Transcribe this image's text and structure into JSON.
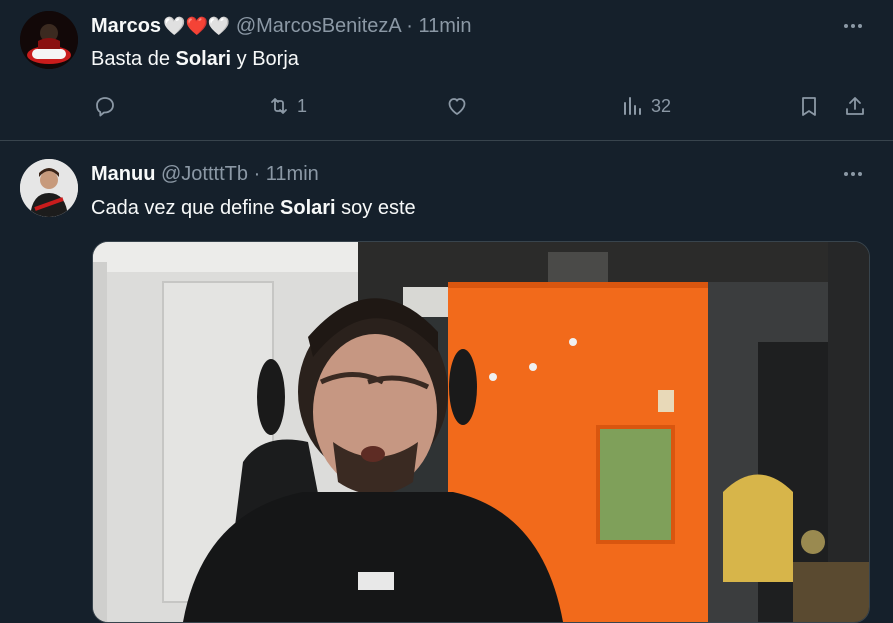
{
  "tweets": [
    {
      "name": "Marcos",
      "name_emojis": "🤍❤️🤍",
      "handle": "@MarcosBenitezA",
      "separator": "·",
      "time": "11min",
      "text_before": "Basta de ",
      "text_bold": "Solari",
      "text_after": " y Borja",
      "actions": {
        "reply_count": "",
        "retweet_count": "1",
        "like_count": "",
        "views_count": "32"
      }
    },
    {
      "name": "Manuu",
      "handle": "@JottttTb",
      "separator": "·",
      "time": "11min",
      "text_before": "Cada vez que define ",
      "text_bold": "Solari",
      "text_after": " soy este"
    }
  ],
  "icons": {
    "more": "more-icon",
    "reply": "reply-icon",
    "retweet": "retweet-icon",
    "like": "heart-icon",
    "views": "views-icon",
    "bookmark": "bookmark-icon",
    "share": "share-icon"
  },
  "colors": {
    "background": "#15202b",
    "text": "#f7f9f9",
    "muted": "#8b98a5",
    "divider": "#38444d",
    "heart_red": "#e0245e",
    "orange_wall": "#f26a1b"
  }
}
